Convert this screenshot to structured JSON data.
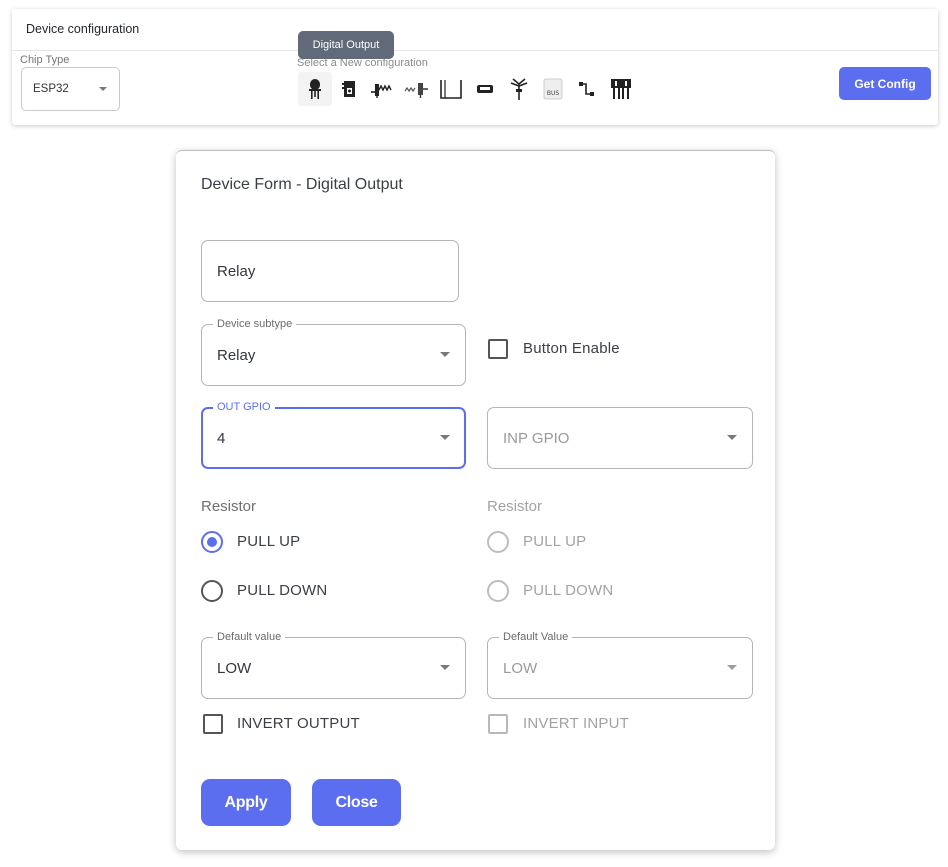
{
  "top": {
    "title": "Device configuration",
    "chip_type_label": "Chip Type",
    "chip_type_value": "ESP32",
    "config_label": "Select a New configuration",
    "tooltip": "Digital Output",
    "get_config_label": "Get Config",
    "icons": [
      {
        "name": "led-icon",
        "selected": true
      },
      {
        "name": "sensor-module-icon"
      },
      {
        "name": "resistor-icon"
      },
      {
        "name": "potentiometer-icon"
      },
      {
        "name": "pulse-wave-icon"
      },
      {
        "name": "display-icon"
      },
      {
        "name": "antenna-icon"
      },
      {
        "name": "bus-module-icon"
      },
      {
        "name": "circuit-icon"
      },
      {
        "name": "multi-pin-icon"
      }
    ]
  },
  "form": {
    "title": "Device Form - Digital Output",
    "name_value": "Relay",
    "subtype": {
      "legend": "Device subtype",
      "value": "Relay"
    },
    "button_enable_label": "Button Enable",
    "out_gpio": {
      "legend": "OUT GPIO",
      "value": "4"
    },
    "inp_gpio": {
      "placeholder": "INP GPIO"
    },
    "left_resistor": {
      "label": "Resistor",
      "options": [
        {
          "label": "PULL UP",
          "checked": true
        },
        {
          "label": "PULL DOWN",
          "checked": false
        }
      ]
    },
    "right_resistor": {
      "label": "Resistor",
      "options": [
        {
          "label": "PULL UP",
          "checked": false
        },
        {
          "label": "PULL DOWN",
          "checked": false
        }
      ]
    },
    "default_value": {
      "legend": "Default value",
      "value": "LOW"
    },
    "default_value_right": {
      "legend": "Default Value",
      "value": "LOW"
    },
    "invert_output_label": "INVERT OUTPUT",
    "invert_input_label": "INVERT INPUT",
    "apply_label": "Apply",
    "close_label": "Close"
  },
  "colors": {
    "accent": "#5c6ef0",
    "tooltip_bg": "#616a79",
    "muted_text": "#a3a3a3"
  }
}
